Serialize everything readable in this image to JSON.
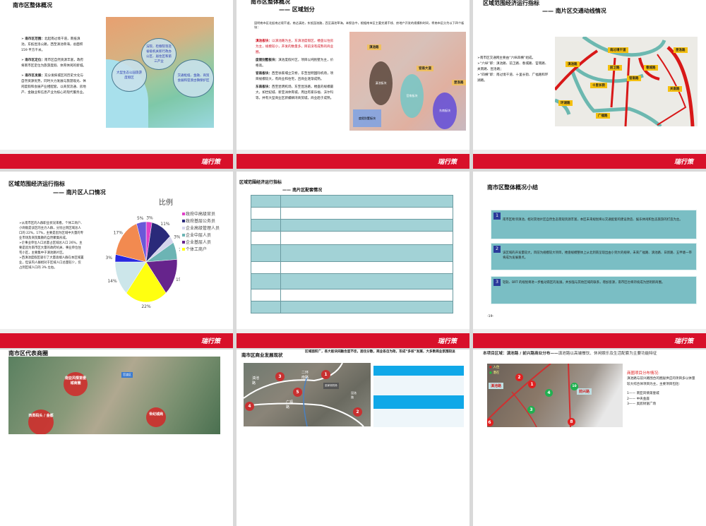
{
  "footer_logo": "瑞行策",
  "slide1": {
    "title": "南市区整体概况",
    "bullets": [
      {
        "head": "南市区范围：",
        "text": "北起南过境干道，南抵滇池，东抵昆洛公路，西至滇池草海，总面积 159 平方千米。"
      },
      {
        "head": "南市区定位：",
        "text": "南市区自然资源丰富，政府将南市区定位为旅游度假、体育休闲的新城。"
      },
      {
        "head": "南市区发展：",
        "text": "充分发挥城区的历史文化与自然资源优势，同时大力发展与旅游观光、休闲度假和会展产业相配套，以商贸流通、房地产、金融业和信息产业为核心的现代服务业。"
      }
    ],
    "bubbles": [
      "法院、检察院等及省级机关新行政办公区、居住区和第三产业",
      "大型生态公园旅游度假区",
      "交通枢纽、金融、商贸会展和官渡古镇保护区"
    ]
  },
  "slide2": {
    "title": "南市区整体概况",
    "subtitle": "—— 区域划分",
    "intro": "昆明南市区北起南过境干道，南达滇池，东抵昆洛路，西至滇池草海。本报告中，根据南市区主要交通干线、房地产开发的规模和时间，将南市区分为以下四个板块：",
    "blocks": [
      {
        "head": "滇池板块：",
        "text": "以滇池路为主，东滇池度假区，楼盘以住房为主，规模较小，开发的数量多，目前没有成熟的商业圈。"
      },
      {
        "head": "度假别墅板块：",
        "text": "滇池度假片区，项目以纯别墅为主，价格高。"
      },
      {
        "head": "官南板块：",
        "text": "西至徐家埔立交桥，东至昆明国际机场，项目规模较大，有商业和住宅，且商业逐渐成熟。"
      },
      {
        "head": "东南板块：",
        "text": "西至昆明机场，东至昆洛路，楼盘的规模最大，如世纪城、新亚洲体育城，周边有家乐福、沃尔玛等，并有大型商业区新螺蛳湾商贸城，商业趋于成熟。"
      }
    ],
    "map_labels": [
      "滇池路",
      "官南大道",
      "昆洛路",
      "滇池板块",
      "官南板块",
      "度假别墅板块",
      "东南板块"
    ]
  },
  "slide3": {
    "title": "区域范围经济运行指标",
    "subtitle": "—— 南片区交通动线情况",
    "bullets": [
      "南市区交通网主要由“六纵四横”组成。",
      "“六纵”即：滇池路、前卫路、春城路、官南路、关南路、昆洛路；",
      "“四横”即：南过境干道、十里长街、广福路和环湖路。"
    ],
    "map_labels": [
      "南过境干道",
      "昆洛路",
      "滇池路",
      "前卫路",
      "春城路",
      "官南路",
      "十里长街",
      "关南路",
      "环湖路",
      "广福路"
    ]
  },
  "slide4": {
    "title": "区域范围经济运行指标",
    "subtitle": "—— 南片区人口情况",
    "paragraphs": [
      "➢从南市区的人群职业状况来看，个体工商户、小商贩是该区的主力人群，分别占到区域总人口的 22%，17%，主要是因为区域中大量的专业市场及商贸集散的自然聚集形成。",
      "➢企事业单位人口总量占区域总人口 26%，主要是因为南市区大量的政府机关、事业单位住宅小区，主要集中于滇池路片区。",
      "➢西滇池度假区吸引了大量高端人群在本区域置业，但该内人群相对于区域人口总量较少，仅占到区域人口的 3% 左右。"
    ]
  },
  "chart_data": {
    "type": "pie",
    "title": "比例",
    "slices": [
      {
        "label": "政府中高级官员",
        "value": 3,
        "color": "#e040c8"
      },
      {
        "label": "政府基层公务员",
        "value": 11,
        "color": "#2a2a7a"
      },
      {
        "label": "企业高级管理人员",
        "value": 3,
        "color": "#d4d4ec"
      },
      {
        "label": "企业中层人员",
        "value": 7,
        "color": "#6cb4b4"
      },
      {
        "label": "企业基层人员",
        "value": 15,
        "color": "#66248c"
      },
      {
        "label": "个体工商户",
        "value": 22,
        "color": "#ffff10"
      },
      {
        "label": "",
        "value": 14,
        "color": "#cce6ea"
      },
      {
        "label": "",
        "value": 3,
        "color": "#2828e0"
      },
      {
        "label": "",
        "value": 17,
        "color": "#f28a50"
      },
      {
        "label": "",
        "value": 5,
        "color": "#6a58d8"
      }
    ],
    "legend": [
      "政府中高级官员",
      "政府基层公务员",
      "企业高级管理人员",
      "企业中层人员",
      "企业基层人员",
      "个体工商户"
    ],
    "legend_position": "right"
  },
  "slide5": {
    "title": "区域范围经济运行指标",
    "subtitle": "—— 南片区配套情况"
  },
  "slide6": {
    "title": "南市区整体概况小结",
    "items": [
      {
        "n": "1",
        "text": "南市区毗邻滇池，相对其他片区自然生态景观资源丰富，本区未来规划将以交通配套的建设改造、娱乐休闲和生态旅游的打造为主。"
      },
      {
        "n": "2",
        "text": "该区域的开发量较大，目前为规模较大项目，楼盘规模整体上从北到南呈现出由小到大的规律，未来广福路、滇池路、日新路、五甲塘一带将成为发展重点。"
      },
      {
        "n": "3",
        "text": "轻轨、BRT 的规划将进一步推动南区的发展，并加强与其他区域的联系，增加客源，南市区也将持续成为昆明新商圈。"
      }
    ],
    "page": "-19-"
  },
  "slide7": {
    "title": "南市区代表商圈",
    "labels": [
      "南亚风情第壹城商圈",
      "西贡码头 / 金都",
      "世纪城商",
      "官渡区"
    ]
  },
  "slide8": {
    "title": "南市区商业发展现状",
    "desc": "区域面积广，各大板块间融合度不佳，居住分散，商业各自为政，形成“多核”发展，大多数商业氛围较淡",
    "markers": [
      "1",
      "2",
      "3",
      "4",
      "5"
    ],
    "labels": [
      "二环南路",
      "滇池路",
      "广福路",
      "昆洛路",
      "巫家坝机场"
    ]
  },
  "slide9": {
    "title": "本项目区域：滇池路 / 前兴路商业分布——",
    "title_rest": "滇池路以高端餐饮、休闲娱乐及生活配套为主要功能特征",
    "legend": [
      "入住",
      "潜在"
    ],
    "roads": [
      "滇池路",
      "前兴路"
    ],
    "markers_red": [
      "1",
      "2",
      "6",
      "8"
    ],
    "markers_green": [
      "3",
      "4",
      "10"
    ],
    "side_title": "商圈项目分布情况:",
    "side_text": "滇池路与前兴路围合的圈层供应的项目多以体量较大综合体项目为主，主要项目包括:",
    "projects": [
      "1—— 南亚风情第壹城",
      "2—— 中央金座",
      "3—— 奥宸财富广场"
    ]
  }
}
